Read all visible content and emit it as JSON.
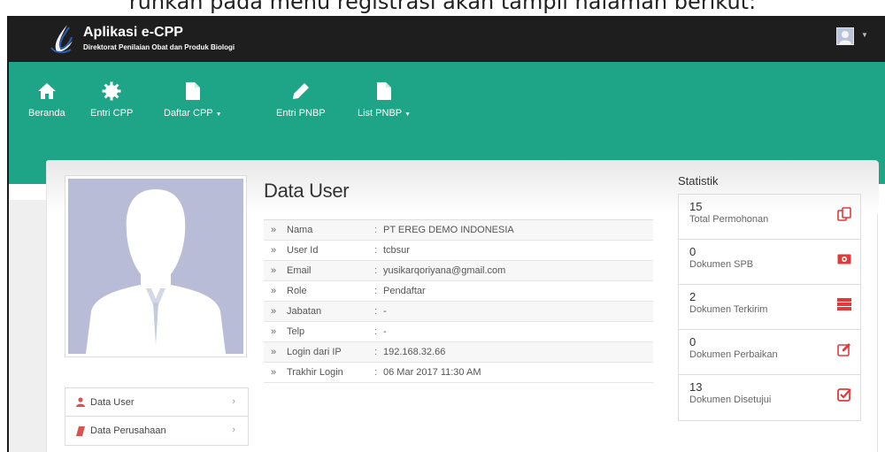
{
  "caption": "ruhkan pada menu registrasi akan tampil halaman berikut:",
  "app": {
    "title": "Aplikasi e-CPP",
    "subtitle": "Direktorat Penilaian Obat dan Produk Biologi"
  },
  "nav": [
    {
      "label": "Beranda",
      "icon": "home-icon",
      "caret": ""
    },
    {
      "label": "Entri CPP",
      "icon": "gear-icon",
      "caret": ""
    },
    {
      "label": "Daftar CPP",
      "icon": "file-icon",
      "caret": "▼"
    },
    {
      "label": "Entri PNBP",
      "icon": "pencil-icon",
      "caret": ""
    },
    {
      "label": "List PNBP",
      "icon": "file-icon",
      "caret": "▼"
    }
  ],
  "profile": {
    "title": "Data User",
    "rows": [
      {
        "arrow": "»",
        "key": "Nama",
        "sep": ":",
        "value": "PT EREG DEMO INDONESIA"
      },
      {
        "arrow": "»",
        "key": "User Id",
        "sep": ":",
        "value": "tcbsur"
      },
      {
        "arrow": "»",
        "key": "Email",
        "sep": ":",
        "value": "yusikarqoriyana@gmail.com"
      },
      {
        "arrow": "»",
        "key": "Role",
        "sep": ":",
        "value": "Pendaftar"
      },
      {
        "arrow": "»",
        "key": "Jabatan",
        "sep": ":",
        "value": "-"
      },
      {
        "arrow": "»",
        "key": "Telp",
        "sep": ":",
        "value": "-"
      },
      {
        "arrow": "»",
        "key": "Login dari IP",
        "sep": ":",
        "value": "192.168.32.66"
      },
      {
        "arrow": "»",
        "key": "Trakhir Login",
        "sep": ":",
        "value": "06 Mar 2017 11:30 AM"
      }
    ]
  },
  "side_menu": [
    {
      "label": "Data User",
      "icon": "user-icon",
      "chevron": "›"
    },
    {
      "label": "Data Perusahaan",
      "icon": "book-icon",
      "chevron": "›"
    }
  ],
  "stats": {
    "title": "Statistik",
    "items": [
      {
        "value": "15",
        "label": "Total Permohonan",
        "icon": "copy-icon"
      },
      {
        "value": "0",
        "label": "Dokumen SPB",
        "icon": "money-icon"
      },
      {
        "value": "2",
        "label": "Dokumen Terkirim",
        "icon": "server-icon"
      },
      {
        "value": "0",
        "label": "Dokumen Perbaikan",
        "icon": "edit-icon"
      },
      {
        "value": "13",
        "label": "Dokumen Disetujui",
        "icon": "check-square-icon"
      }
    ]
  },
  "colors": {
    "topbar": "#1e1e1e",
    "nav_bg": "#1ea486",
    "stat_icon": "#e03a3a",
    "user_icon": "#d9534f"
  }
}
